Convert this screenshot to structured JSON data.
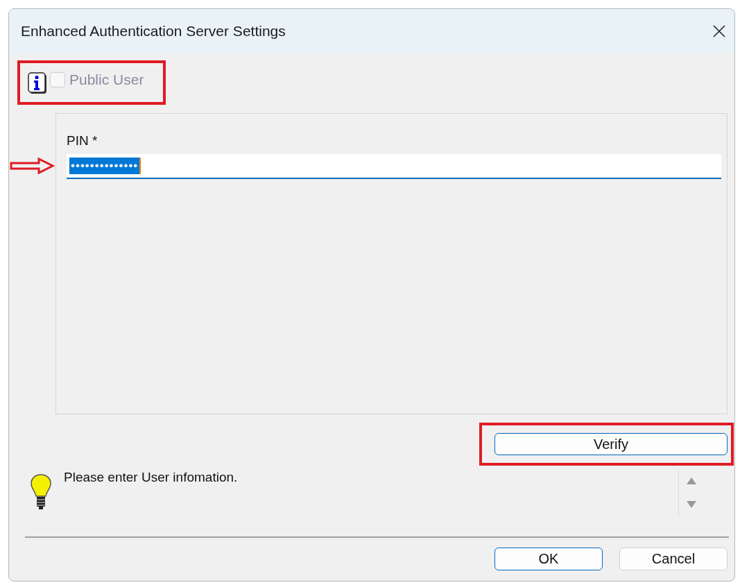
{
  "window": {
    "title": "Enhanced Authentication Server Settings"
  },
  "public_user": {
    "label": "Public User",
    "checked": false,
    "disabled": true
  },
  "pin": {
    "label": "PIN *",
    "value": "••••••••••••••",
    "selected": true
  },
  "verify_button": "Verify",
  "message": "Please enter User infomation.",
  "buttons": [
    {
      "label": "OK",
      "default": true
    },
    {
      "label": "Cancel",
      "default": false
    }
  ]
}
